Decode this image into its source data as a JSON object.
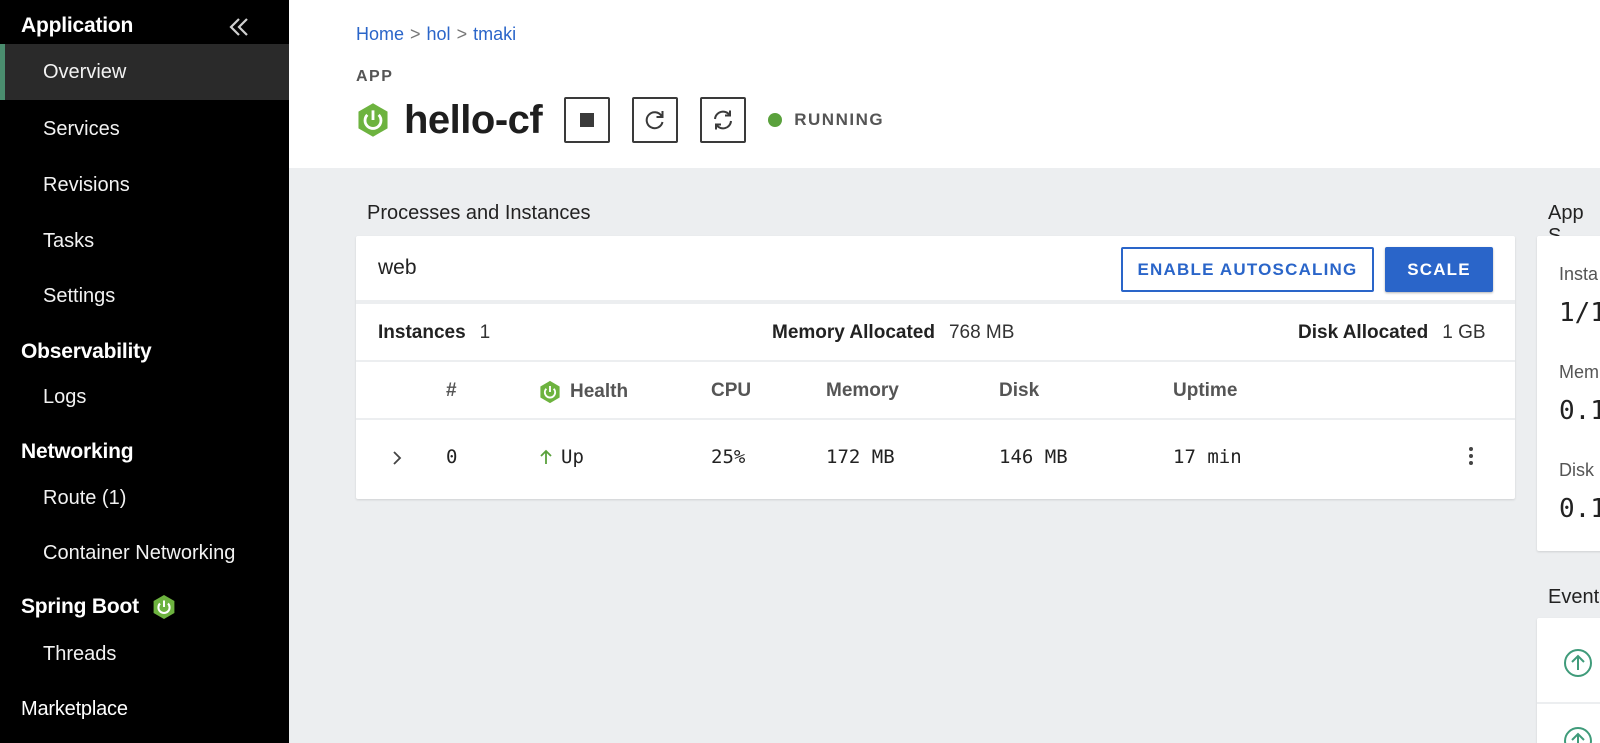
{
  "sidebar": {
    "sections": [
      {
        "label": "Application"
      },
      {
        "label": "Observability"
      },
      {
        "label": "Networking"
      },
      {
        "label": "Spring Boot"
      },
      {
        "label": "Marketplace"
      }
    ],
    "items": [
      {
        "label": "Overview",
        "active": true
      },
      {
        "label": "Services"
      },
      {
        "label": "Revisions"
      },
      {
        "label": "Tasks"
      },
      {
        "label": "Settings"
      },
      {
        "label": "Logs"
      },
      {
        "label": "Route (1)"
      },
      {
        "label": "Container Networking"
      },
      {
        "label": "Threads"
      }
    ]
  },
  "breadcrumb": {
    "items": [
      "Home",
      "hol",
      "tmaki"
    ],
    "separator": ">"
  },
  "header": {
    "kicker": "APP",
    "title": "hello-cf",
    "status": "RUNNING",
    "status_color": "#5aa13c",
    "controls": [
      {
        "icon": "stop-icon"
      },
      {
        "icon": "restart-icon"
      },
      {
        "icon": "restage-icon"
      }
    ]
  },
  "processes": {
    "section_title": "Processes and Instances",
    "process_name": "web",
    "enable_autoscaling_label": "ENABLE AUTOSCALING",
    "scale_label": "SCALE",
    "stats": {
      "instances_label": "Instances",
      "instances_value": "1",
      "memory_label": "Memory Allocated",
      "memory_value": "768 MB",
      "disk_label": "Disk Allocated",
      "disk_value": "1 GB"
    },
    "columns": [
      "#",
      "Health",
      "CPU",
      "Memory",
      "Disk",
      "Uptime"
    ],
    "rows": [
      {
        "index": "0",
        "health": "Up",
        "cpu": "25%",
        "memory": "172 MB",
        "disk": "146 MB",
        "uptime": "17 min"
      }
    ]
  },
  "right": {
    "summary_title": "App S",
    "labels": [
      "Insta",
      "Mem",
      "Disk"
    ],
    "values": [
      "1/1",
      "0.1",
      "0.1"
    ],
    "events_title": "Event"
  },
  "colors": {
    "accent": "#2a65c9",
    "spring_green": "#6db33f",
    "sidebar_bg": "#000000"
  }
}
